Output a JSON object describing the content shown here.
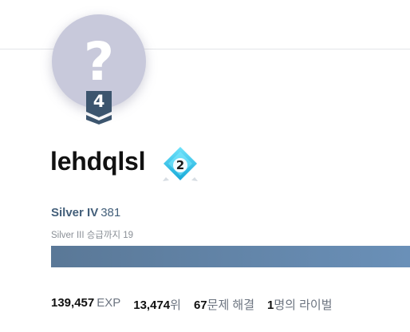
{
  "profile": {
    "avatar_symbol": "?",
    "level_badge": "4",
    "username": "lehdqlsl",
    "class_badge": "2"
  },
  "tier": {
    "name": "Silver IV",
    "rating": "381",
    "promotion_text": "Silver III 승급까지 19",
    "progress_fraction": 1.0
  },
  "stats": {
    "exp_value": "139,457",
    "exp_label": "EXP",
    "rank_value": "13,474",
    "rank_label": "위",
    "solved_value": "67",
    "solved_label": "문제 해결",
    "rivals_value": "1",
    "rivals_label": "명의 라이벌"
  },
  "colors": {
    "tier_text": "#435f7a",
    "progress": "#6a90b8",
    "avatar_bg": "#c8c9db",
    "class_badge": "#29c6e8"
  },
  "icons": {
    "avatar": "question-mark-avatar-icon",
    "level": "chevron-badge-icon",
    "class": "diamond-class-icon"
  }
}
